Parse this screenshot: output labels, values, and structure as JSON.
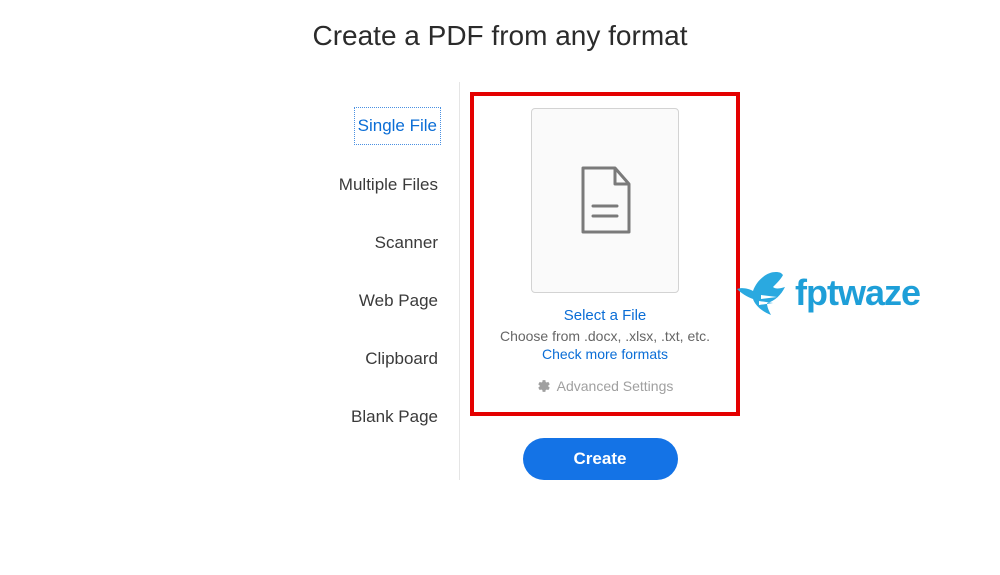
{
  "title": "Create a PDF from any format",
  "sidebar": {
    "items": [
      {
        "label": "Single File",
        "selected": true
      },
      {
        "label": "Multiple Files",
        "selected": false
      },
      {
        "label": "Scanner",
        "selected": false
      },
      {
        "label": "Web Page",
        "selected": false
      },
      {
        "label": "Clipboard",
        "selected": false
      },
      {
        "label": "Blank Page",
        "selected": false
      }
    ]
  },
  "panel": {
    "select_file_label": "Select a File",
    "helper_text": "Choose from .docx, .xlsx, .txt, etc.",
    "check_formats_label": "Check more formats",
    "advanced_settings_label": "Advanced Settings"
  },
  "actions": {
    "create_label": "Create"
  },
  "watermark": {
    "text": "fptwaze"
  }
}
